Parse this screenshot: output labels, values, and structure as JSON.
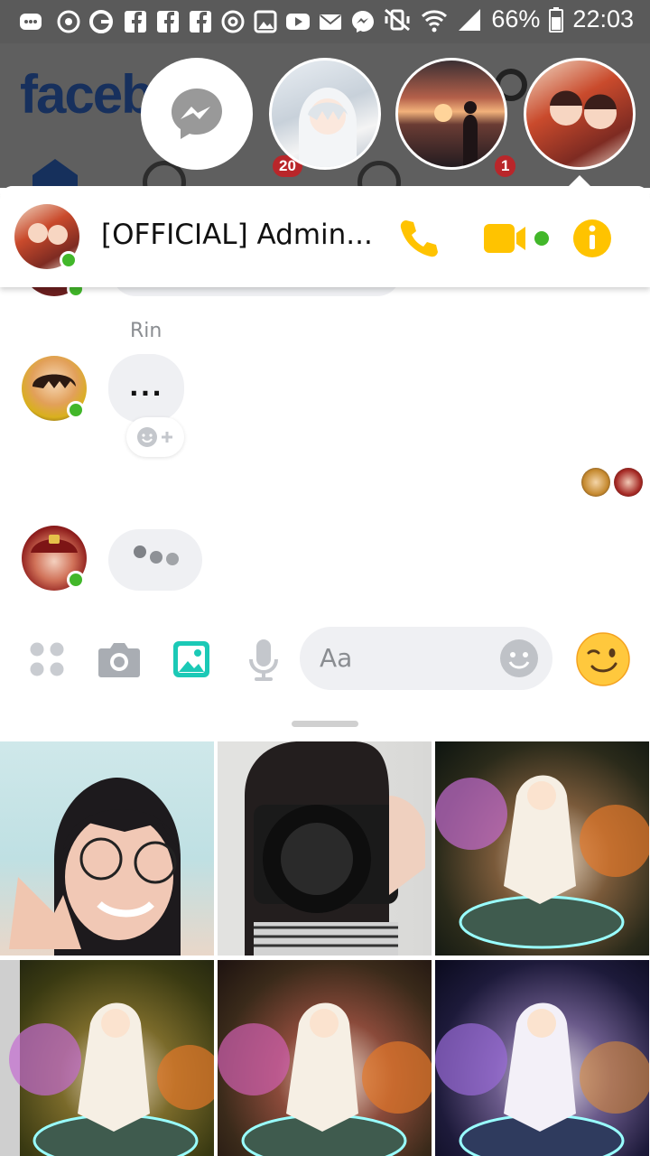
{
  "status_bar": {
    "battery": "66%",
    "time": "22:03"
  },
  "background_app": {
    "logo_text": "faceb",
    "watch_badge": "20",
    "notif_badge": "1"
  },
  "chat_heads": [
    {
      "name": "messenger-chathead"
    },
    {
      "name": "anime-girl-chathead"
    },
    {
      "name": "sunset-chathead"
    },
    {
      "name": "group-chathead"
    }
  ],
  "conversation": {
    "title": "[OFFICIAL] Admin...",
    "sender_name": "Rin",
    "message_text": "...",
    "input_placeholder": "Aa"
  },
  "colors": {
    "accent": "#ffc300",
    "online": "#42b72a",
    "gallery_icon": "#1bc9b6"
  },
  "icons": {
    "call": "phone-icon",
    "video": "video-camera-icon",
    "info": "info-icon",
    "more": "grid-dots-icon",
    "camera": "camera-icon",
    "gallery": "image-icon",
    "mic": "microphone-icon",
    "emoji": "smiley-icon",
    "quick_reaction": "wink-emoji-icon"
  },
  "gallery": {
    "items": [
      {
        "label": "selfie-photo"
      },
      {
        "label": "camera-photo"
      },
      {
        "label": "anime-artwork-1"
      },
      {
        "label": "anime-artwork-2"
      },
      {
        "label": "anime-artwork-3"
      },
      {
        "label": "anime-artwork-4"
      }
    ]
  }
}
